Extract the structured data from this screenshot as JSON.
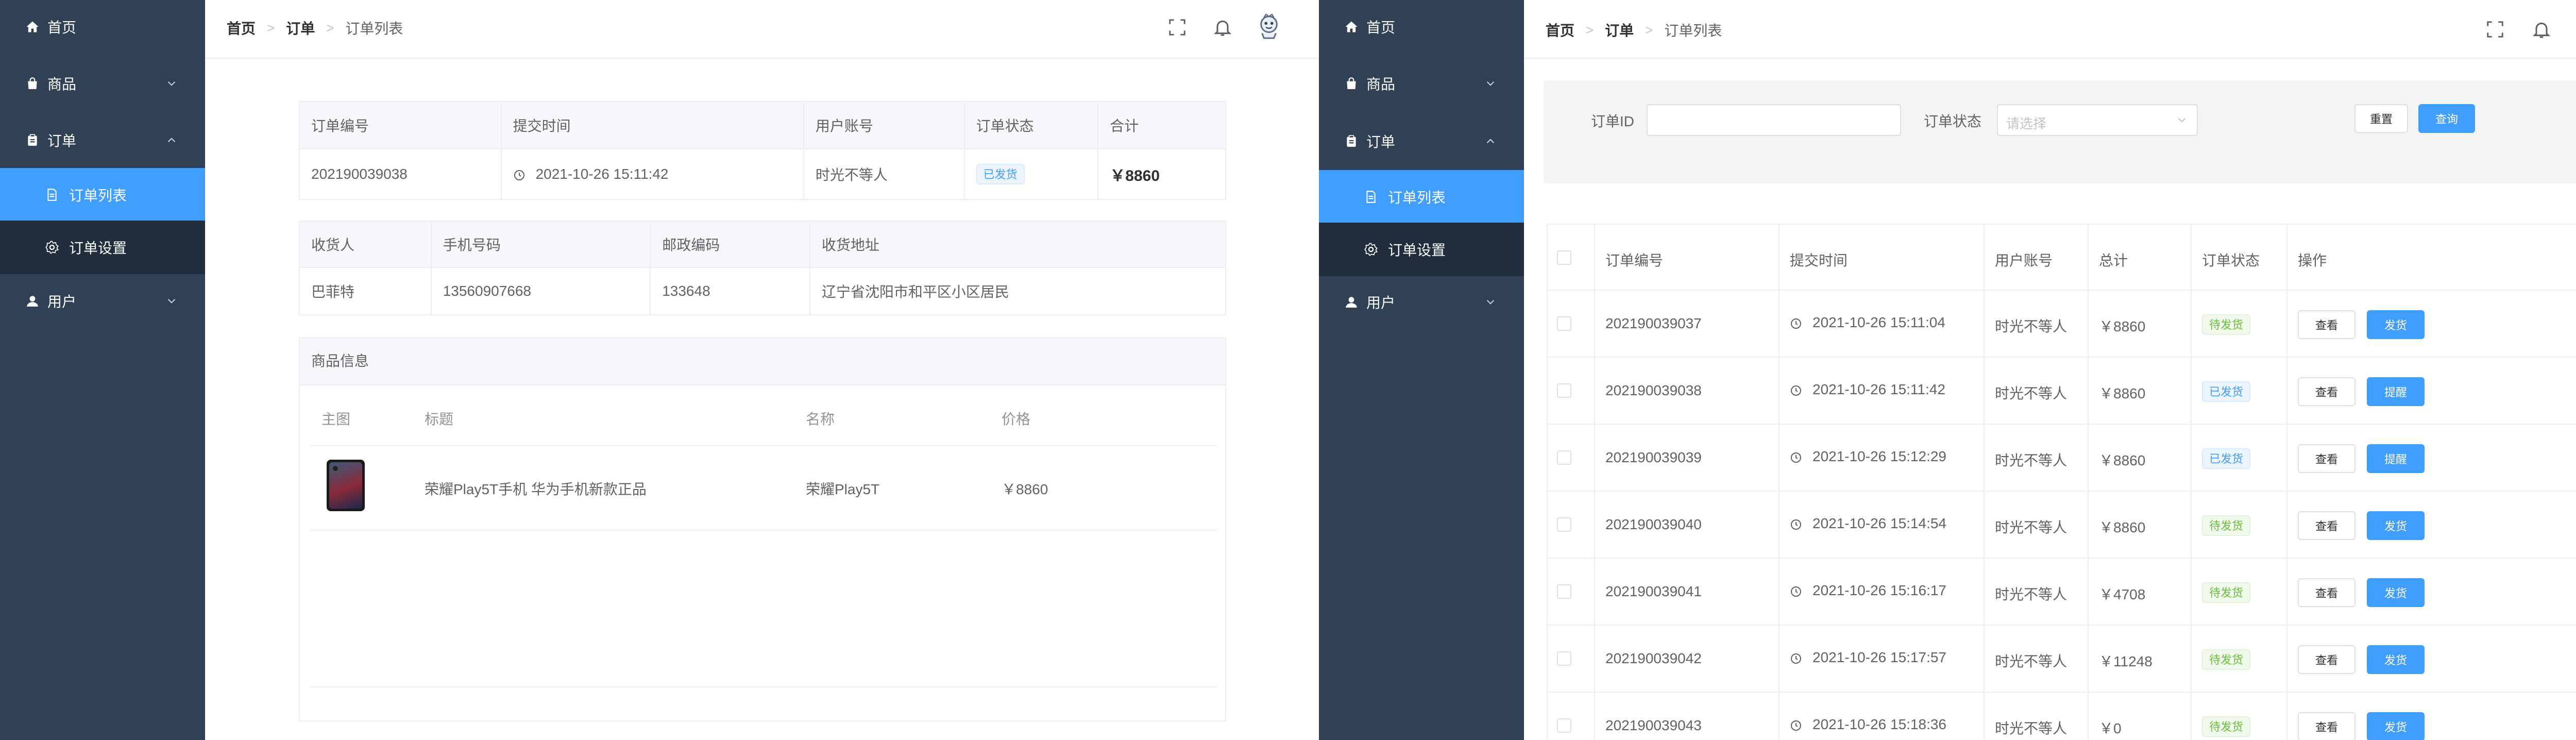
{
  "menu": {
    "home": "首页",
    "goods": "商品",
    "order": "订单",
    "order_list": "订单列表",
    "order_settings": "订单设置",
    "user": "用户"
  },
  "breadcrumb": {
    "home": "首页",
    "order": "订单",
    "current": "订单列表"
  },
  "detail": {
    "order_table": {
      "headers": [
        "订单编号",
        "提交时间",
        "用户账号",
        "订单状态",
        "合计"
      ],
      "row": {
        "order_no": "202190039038",
        "time": "2021-10-26 15:11:42",
        "account": "时光不等人",
        "status": "已发货",
        "total": "￥8860"
      }
    },
    "receiver_table": {
      "headers": [
        "收货人",
        "手机号码",
        "邮政编码",
        "收货地址"
      ],
      "row": {
        "name": "巴菲特",
        "phone": "13560907668",
        "postcode": "133648",
        "address": "辽宁省沈阳市和平区小区居民"
      }
    },
    "goods": {
      "title": "商品信息",
      "headers": [
        "主图",
        "标题",
        "名称",
        "价格"
      ],
      "row": {
        "title": "荣耀Play5T手机 华为手机新款正品",
        "name": "荣耀Play5T",
        "price": "￥8860"
      }
    }
  },
  "list": {
    "filter": {
      "order_id_label": "订单ID",
      "order_id_value": "",
      "status_label": "订单状态",
      "status_placeholder": "请选择",
      "reset": "重置",
      "search": "查询"
    },
    "headers": [
      "订单编号",
      "提交时间",
      "用户账号",
      "总计",
      "订单状态",
      "操作"
    ],
    "rows": [
      {
        "order_no": "202190039037",
        "time": "2021-10-26 15:11:04",
        "account": "时光不等人",
        "total": "￥8860",
        "status": "待发货",
        "status_type": "green",
        "view": "查看",
        "action": "发货"
      },
      {
        "order_no": "202190039038",
        "time": "2021-10-26 15:11:42",
        "account": "时光不等人",
        "total": "￥8860",
        "status": "已发货",
        "status_type": "blue",
        "view": "查看",
        "action": "提醒"
      },
      {
        "order_no": "202190039039",
        "time": "2021-10-26 15:12:29",
        "account": "时光不等人",
        "total": "￥8860",
        "status": "已发货",
        "status_type": "blue",
        "view": "查看",
        "action": "提醒"
      },
      {
        "order_no": "202190039040",
        "time": "2021-10-26 15:14:54",
        "account": "时光不等人",
        "total": "￥8860",
        "status": "待发货",
        "status_type": "green",
        "view": "查看",
        "action": "发货"
      },
      {
        "order_no": "202190039041",
        "time": "2021-10-26 15:16:17",
        "account": "时光不等人",
        "total": "￥4708",
        "status": "待发货",
        "status_type": "green",
        "view": "查看",
        "action": "发货"
      },
      {
        "order_no": "202190039042",
        "time": "2021-10-26 15:17:57",
        "account": "时光不等人",
        "total": "￥11248",
        "status": "待发货",
        "status_type": "green",
        "view": "查看",
        "action": "发货"
      },
      {
        "order_no": "202190039043",
        "time": "2021-10-26 15:18:36",
        "account": "时光不等人",
        "total": "￥0",
        "status": "待发货",
        "status_type": "green",
        "view": "查看",
        "action": "发货"
      }
    ]
  },
  "colors": {
    "sidebar": "#304156",
    "submenu": "#1f2d3d",
    "accent": "#409eff",
    "success": "#67c23a"
  },
  "icons": [
    "home-icon",
    "bag-icon",
    "clipboard-icon",
    "document-icon",
    "gear-icon",
    "user-icon",
    "chevron-down-icon",
    "chevron-up-icon",
    "fullscreen-icon",
    "bell-icon",
    "avatar",
    "clock-icon"
  ]
}
